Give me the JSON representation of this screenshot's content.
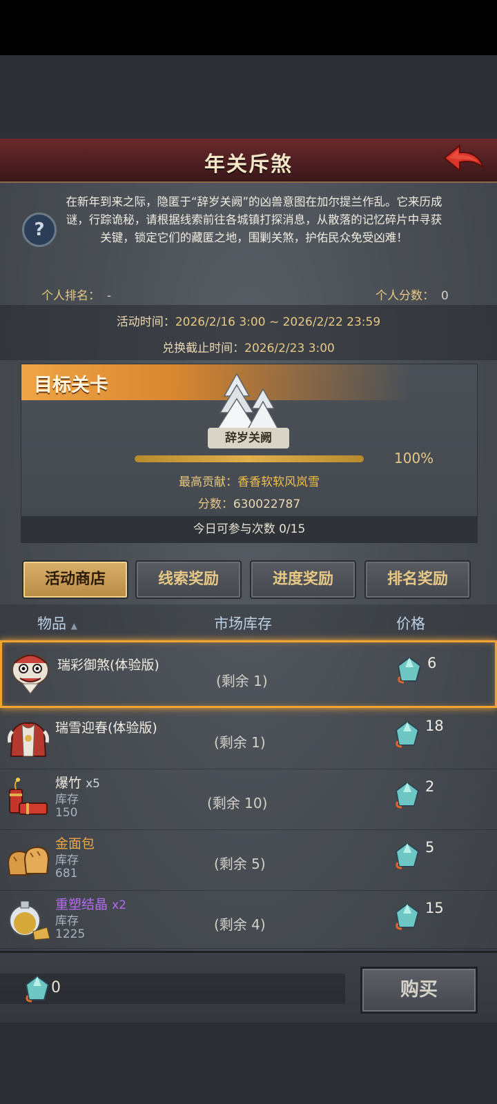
{
  "header": {
    "title": "年关斥煞"
  },
  "intro": {
    "text": "在新年到来之际，隐匿于“辞岁关阙”的凶兽意图在加尔提兰作乱。它来历成谜，行踪诡秘，请根据线索前往各城镇打探消息，从散落的记忆碎片中寻获关键，锁定它们的藏匿之地，围剿关煞，护佑民众免受凶难！"
  },
  "ranking": {
    "rank_label": "个人排名：",
    "rank_value": "-",
    "score_label": "个人分数：",
    "score_value": "0"
  },
  "times": {
    "event_label": "活动时间：",
    "event_value": "2026/2/16 3:00 ~ 2026/2/22 23:59",
    "exchange_label": "兑换截止时间：",
    "exchange_value": "2026/2/23 3:00"
  },
  "target": {
    "heading": "目标关卡",
    "stage_name": "辞岁关阙",
    "progress_percent": 100,
    "progress_text": "100%",
    "best_label": "最高贡献：",
    "best_value": "香香软软风岚雪",
    "score_label": "分数：",
    "score_value": "630022787",
    "daily_text": "今日可参与次数 0/15"
  },
  "tabs": [
    {
      "label": "活动商店",
      "active": true
    },
    {
      "label": "线索奖励",
      "active": false
    },
    {
      "label": "进度奖励",
      "active": false
    },
    {
      "label": "排名奖励",
      "active": false
    }
  ],
  "table": {
    "col_item": "物品",
    "col_stock": "市场库存",
    "col_price": "价格",
    "rows": [
      {
        "name": "瑞彩御煞(体验版)",
        "mult": "",
        "stock_label": "",
        "stock_value": "",
        "remain": "(剩余 1)",
        "price": "6",
        "icon": "lion-dance-head-icon",
        "name_color": "#f2ede2"
      },
      {
        "name": "瑞雪迎春(体验版)",
        "mult": "",
        "stock_label": "",
        "stock_value": "",
        "remain": "(剩余 1)",
        "price": "18",
        "icon": "festive-armor-icon",
        "name_color": "#f2ede2"
      },
      {
        "name": "爆竹",
        "mult": "x5",
        "stock_label": "库存",
        "stock_value": "150",
        "remain": "(剩余 10)",
        "price": "2",
        "icon": "firecracker-icon",
        "name_color": "#f2ede2"
      },
      {
        "name": "金面包",
        "mult": "",
        "stock_label": "库存",
        "stock_value": "681",
        "remain": "(剩余 5)",
        "price": "5",
        "icon": "bread-icon",
        "name_color": "#f0a545"
      },
      {
        "name": "重塑结晶",
        "mult": "x2",
        "stock_label": "库存",
        "stock_value": "1225",
        "remain": "(剩余 4)",
        "price": "15",
        "icon": "crystal-flask-icon",
        "name_color": "#b36cf2"
      }
    ]
  },
  "footer": {
    "currency": "0",
    "buy_label": "购买"
  },
  "colors": {
    "accent": "#f4a431",
    "gold": "#e7c985",
    "header_red": "#5a2326"
  }
}
